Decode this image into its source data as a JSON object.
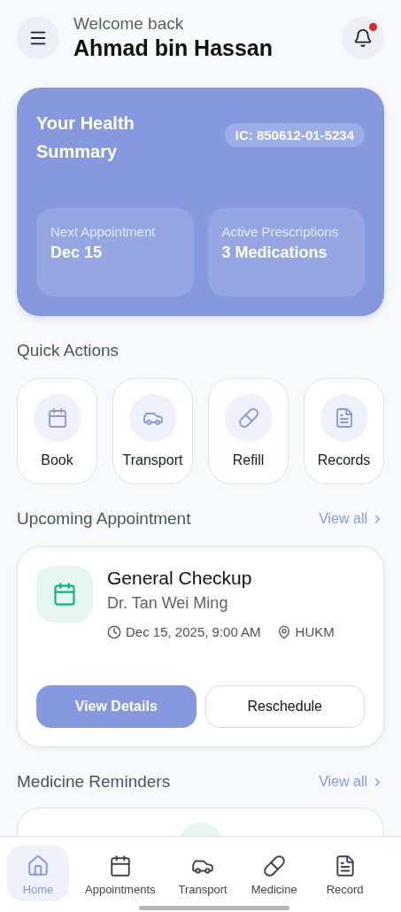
{
  "header": {
    "greeting": "Welcome back",
    "name": "Ahmad bin Hassan",
    "has_notification": true
  },
  "health_summary": {
    "title": "Your Health Summary",
    "ic": "IC: 850612-01-5234",
    "stats": [
      {
        "label": "Next Appointment",
        "value": "Dec 15"
      },
      {
        "label": "Active Prescriptions",
        "value": "3 Medications"
      }
    ]
  },
  "quick_actions": {
    "title": "Quick Actions",
    "items": [
      {
        "kind": "calendar",
        "label": "Book"
      },
      {
        "kind": "car",
        "label": "Transport"
      },
      {
        "kind": "pill",
        "label": "Refill"
      },
      {
        "kind": "file",
        "label": "Records"
      }
    ]
  },
  "upcoming": {
    "title": "Upcoming Appointment",
    "view_all": "View all",
    "appointment": {
      "title": "General Checkup",
      "doctor": "Dr. Tan Wei Ming",
      "datetime": "Dec 15, 2025, 9:00 AM",
      "location": "HUKM"
    },
    "buttons": [
      "View Details",
      "Reschedule"
    ]
  },
  "reminders": {
    "title": "Medicine Reminders",
    "view_all": "View all"
  },
  "nav": [
    {
      "kind": "home",
      "label": "Home",
      "selected": true
    },
    {
      "kind": "calendar",
      "label": "Appointments",
      "selected": false
    },
    {
      "kind": "car",
      "label": "Transport",
      "selected": false
    },
    {
      "kind": "pill",
      "label": "Medicine",
      "selected": false
    },
    {
      "kind": "file",
      "label": "Record",
      "selected": false
    }
  ]
}
